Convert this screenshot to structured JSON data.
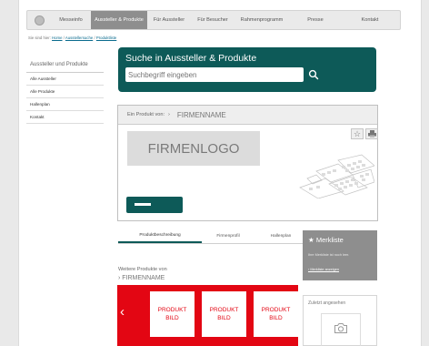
{
  "nav": {
    "items": [
      {
        "label": "Messeinfo",
        "active": false
      },
      {
        "label": "Aussteller & Produkte",
        "active": true
      },
      {
        "label": "Für Aussteller",
        "active": false
      },
      {
        "label": "Für Besucher",
        "active": false
      },
      {
        "label": "Rahmenprogramm",
        "active": false
      },
      {
        "label": "Presse",
        "active": false
      },
      {
        "label": "Kontakt",
        "active": false
      }
    ]
  },
  "breadcrumb": {
    "prefix": "Sie sind hier:",
    "items": [
      "Home",
      "Ausstellersuche",
      "Produktliste"
    ],
    "separator": "/"
  },
  "sidebar": {
    "heading": "Aussteller und Produkte",
    "items": [
      "Alle Aussteller",
      "Alle Produkte",
      "Hallenplan",
      "Kontakt"
    ]
  },
  "search": {
    "title": "Suche in Aussteller & Produkte",
    "placeholder": "Suchbegriff eingeben",
    "icon": "search-icon"
  },
  "company": {
    "prefix": "Ein Produkt von:",
    "name_prefix": "›",
    "name": "FIRMENNAME",
    "logo": "FIRMENLOGO",
    "icons": [
      "star-icon",
      "print-icon"
    ]
  },
  "tabs": [
    {
      "label": "Produktbeschreibung",
      "active": true
    },
    {
      "label": "Firmenprofil",
      "active": false
    },
    {
      "label": "Hallenplan",
      "active": false
    }
  ],
  "merkliste": {
    "icon": "star-icon",
    "title": "Merkliste",
    "text": "Ihre Merkliste ist noch leer.",
    "link": "› Merkliste anzeigen"
  },
  "more_products": {
    "label": "Weitere Produkte von",
    "name": "› FIRMENNAME"
  },
  "carousel": {
    "prev_icon": "chevron-left-icon",
    "next_icon": "chevron-right-icon",
    "cards": [
      {
        "line1": "PRODUKT",
        "line2": "BILD"
      },
      {
        "line1": "PRODUKT",
        "line2": "BILD"
      },
      {
        "line1": "PRODUKT",
        "line2": "BILD"
      }
    ]
  },
  "recent": {
    "title": "Zuletzt angesehen",
    "icon": "camera-icon"
  },
  "colors": {
    "accent": "#0d5a58",
    "highlight": "#e30613",
    "nav_active": "#8e8e8e"
  }
}
